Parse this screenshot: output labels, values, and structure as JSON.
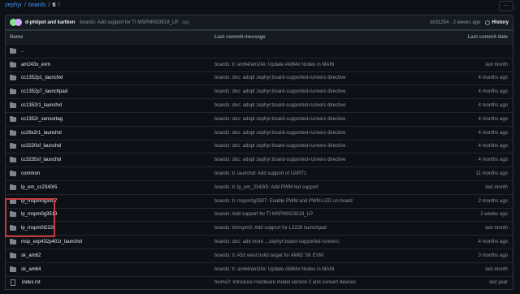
{
  "breadcrumb": [
    "zephyr",
    "boards",
    "ti"
  ],
  "commit": {
    "authors": "d-philpot and kartben",
    "message": "boards: Add support for TI MSPM0G3519_LP",
    "meta": "dc31254 · 2 weeks ago",
    "history_label": "History"
  },
  "table": {
    "headers": {
      "name": "Name",
      "message": "Last commit message",
      "date": "Last commit date"
    },
    "parent": "..",
    "rows": [
      {
        "name": "am243x_evm",
        "type": "folder",
        "message": "boards: ti: am64/am24x: Update AM64x Nodes in MAIN",
        "date": "last month"
      },
      {
        "name": "cc1352p1_launchxl",
        "type": "folder",
        "message": "boards: doc: adopt zephyr:board-supported-runners directive",
        "date": "4 months ago"
      },
      {
        "name": "cc1352p7_launchpad",
        "type": "folder",
        "message": "boards: doc: adopt zephyr:board-supported-runners directive",
        "date": "4 months ago"
      },
      {
        "name": "cc1352r1_launchxl",
        "type": "folder",
        "message": "boards: doc: adopt zephyr:board-supported-runners directive",
        "date": "4 months ago"
      },
      {
        "name": "cc1352r_sensortag",
        "type": "folder",
        "message": "boards: doc: adopt zephyr:board-supported-runners directive",
        "date": "4 months ago"
      },
      {
        "name": "cc26x2r1_launchxl",
        "type": "folder",
        "message": "boards: doc: adopt zephyr:board-supported-runners directive",
        "date": "4 months ago"
      },
      {
        "name": "cc3220sf_launchxl",
        "type": "folder",
        "message": "boards: doc: adopt zephyr:board-supported-runners directive",
        "date": "4 months ago"
      },
      {
        "name": "cc3235sf_launchxl",
        "type": "folder",
        "message": "boards: doc: adopt zephyr:board-supported-runners directive",
        "date": "4 months ago"
      },
      {
        "name": "common",
        "type": "folder",
        "message": "boards: ti: launchxl: Add support of UART1",
        "date": "11 months ago"
      },
      {
        "name": "lp_em_cc2340r5",
        "type": "folder",
        "message": "boards: ti: lp_em_2340r5: Add PWM led support",
        "date": "last month"
      },
      {
        "name": "lp_mspm0g3507",
        "type": "folder",
        "message": "boards: ti: mspm0g3507: Enable PWM and PWM-LED on board",
        "date": "2 months ago"
      },
      {
        "name": "lp_mspm0g3519",
        "type": "folder",
        "message": "boards: Add support for TI MSPM0G3519_LP",
        "date": "2 weeks ago"
      },
      {
        "name": "lp_mspm0l2228",
        "type": "folder",
        "message": "boards: ti/mspm0: Add support for L2228 launchpad",
        "date": "last month"
      },
      {
        "name": "msp_exp432p401r_launchxl",
        "type": "folder",
        "message": "boards: doc: add more ...zephyr:board-supported-runners:",
        "date": "4 months ago"
      },
      {
        "name": "sk_am62",
        "type": "folder",
        "message": "boards: ti: A53 west build target for AM62 SK EVM",
        "date": "3 months ago"
      },
      {
        "name": "sk_am64",
        "type": "folder",
        "message": "boards: ti: am64/am24x: Update AM64x Nodes in MAIN",
        "date": "last month"
      },
      {
        "name": "index.rst",
        "type": "file",
        "message": "hwmv2: Introduce Hardware model version 2 and convert devices",
        "date": "last year"
      }
    ]
  },
  "colors": {
    "highlight": "#c43a3a",
    "link": "#4493f8",
    "background": "#0d1117"
  }
}
